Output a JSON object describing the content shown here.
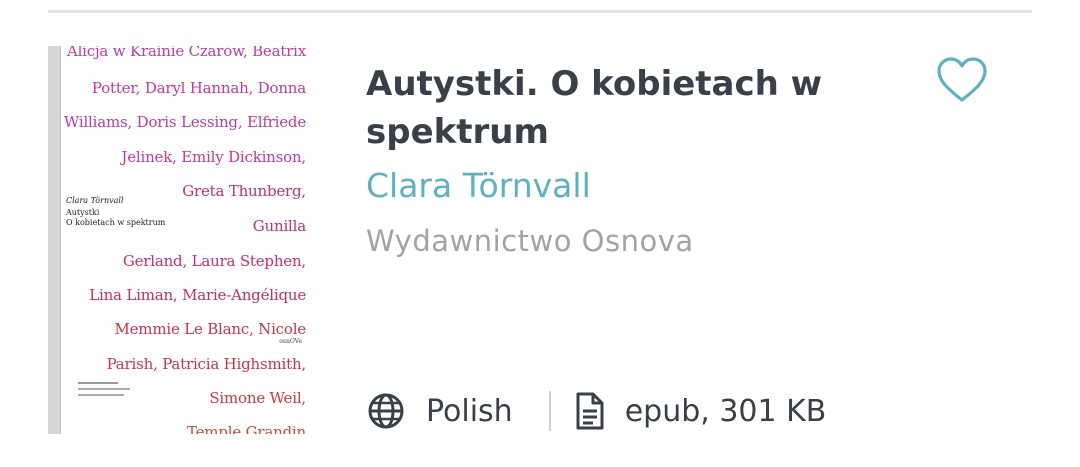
{
  "book": {
    "title": "Autystki. O kobietach w spektrum",
    "author": "Clara Törnvall",
    "publisher": "Wydawnictwo Osnova",
    "language": "Polish",
    "file_info": "epub, 301 KB",
    "favorite": false
  },
  "cover": {
    "lines": [
      {
        "text": "Alicja w Krainie Czarów, Beatrix",
        "color": "#c23aa3"
      },
      {
        "text": "Potter, Daryl Hannah, Donna",
        "color": "#c23aa3"
      },
      {
        "text": "Williams, Doris Lessing, Elfriede",
        "color": "#c23aa3"
      },
      {
        "text": "Jelinek, Emily Dickinson,",
        "color": "#c23aa3"
      },
      {
        "text": "Greta Thunberg,",
        "color": "#c6326e"
      },
      {
        "text": "Gunilla",
        "color": "#c6326e"
      },
      {
        "text": "Gerland, Laura Stephen,",
        "color": "#c6326e"
      },
      {
        "text": "Lina Liman, Marie-Angélique",
        "color": "#c8325a"
      },
      {
        "text": "Memmie Le Blanc, Nicole",
        "color": "#cc3448"
      },
      {
        "text": "Parish, Patricia Highsmith,",
        "color": "#cc3448"
      },
      {
        "text": "Simone Weil,",
        "color": "#cf3a3a"
      },
      {
        "text": "Temple Grandin",
        "color": "#d04a3a"
      }
    ],
    "author": "Clara Törnvall",
    "title_line1": "Autystki",
    "title_line2": "O kobietach w spektrum",
    "small_mark": "osnOVe"
  },
  "icons": {
    "favorite": "heart-outline-icon",
    "language": "globe-icon",
    "file": "document-icon"
  },
  "colors": {
    "title": "#3b3f47",
    "author": "#5bb2c0",
    "publisher": "#a1a3a6",
    "favorite": "#5bb2c0"
  }
}
